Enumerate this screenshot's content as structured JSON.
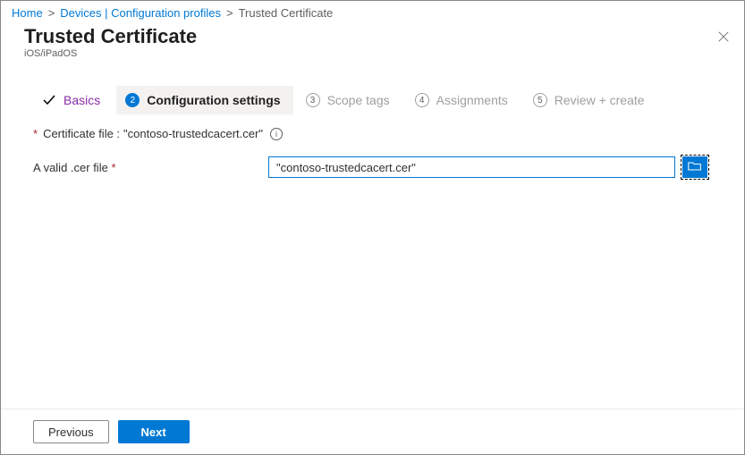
{
  "breadcrumb": {
    "items": [
      {
        "label": "Home",
        "link": true
      },
      {
        "label": "Devices | Configuration profiles",
        "link": true
      },
      {
        "label": "Trusted Certificate",
        "link": false
      }
    ]
  },
  "header": {
    "title": "Trusted Certificate",
    "subtitle": "iOS/iPadOS"
  },
  "stepper": {
    "steps": [
      {
        "label": "Basics",
        "state": "completed"
      },
      {
        "num": "2",
        "label": "Configuration settings",
        "state": "active"
      },
      {
        "num": "3",
        "label": "Scope tags",
        "state": "upcoming"
      },
      {
        "num": "4",
        "label": "Assignments",
        "state": "upcoming"
      },
      {
        "num": "5",
        "label": "Review + create",
        "state": "upcoming"
      }
    ]
  },
  "form": {
    "cert_header_prefix": "Certificate file : ",
    "cert_header_filename": "\"contoso-trustedcacert.cer\"",
    "valid_cer_label": "A valid .cer file",
    "cer_input_value": "\"contoso-trustedcacert.cer\""
  },
  "footer": {
    "previous": "Previous",
    "next": "Next"
  }
}
